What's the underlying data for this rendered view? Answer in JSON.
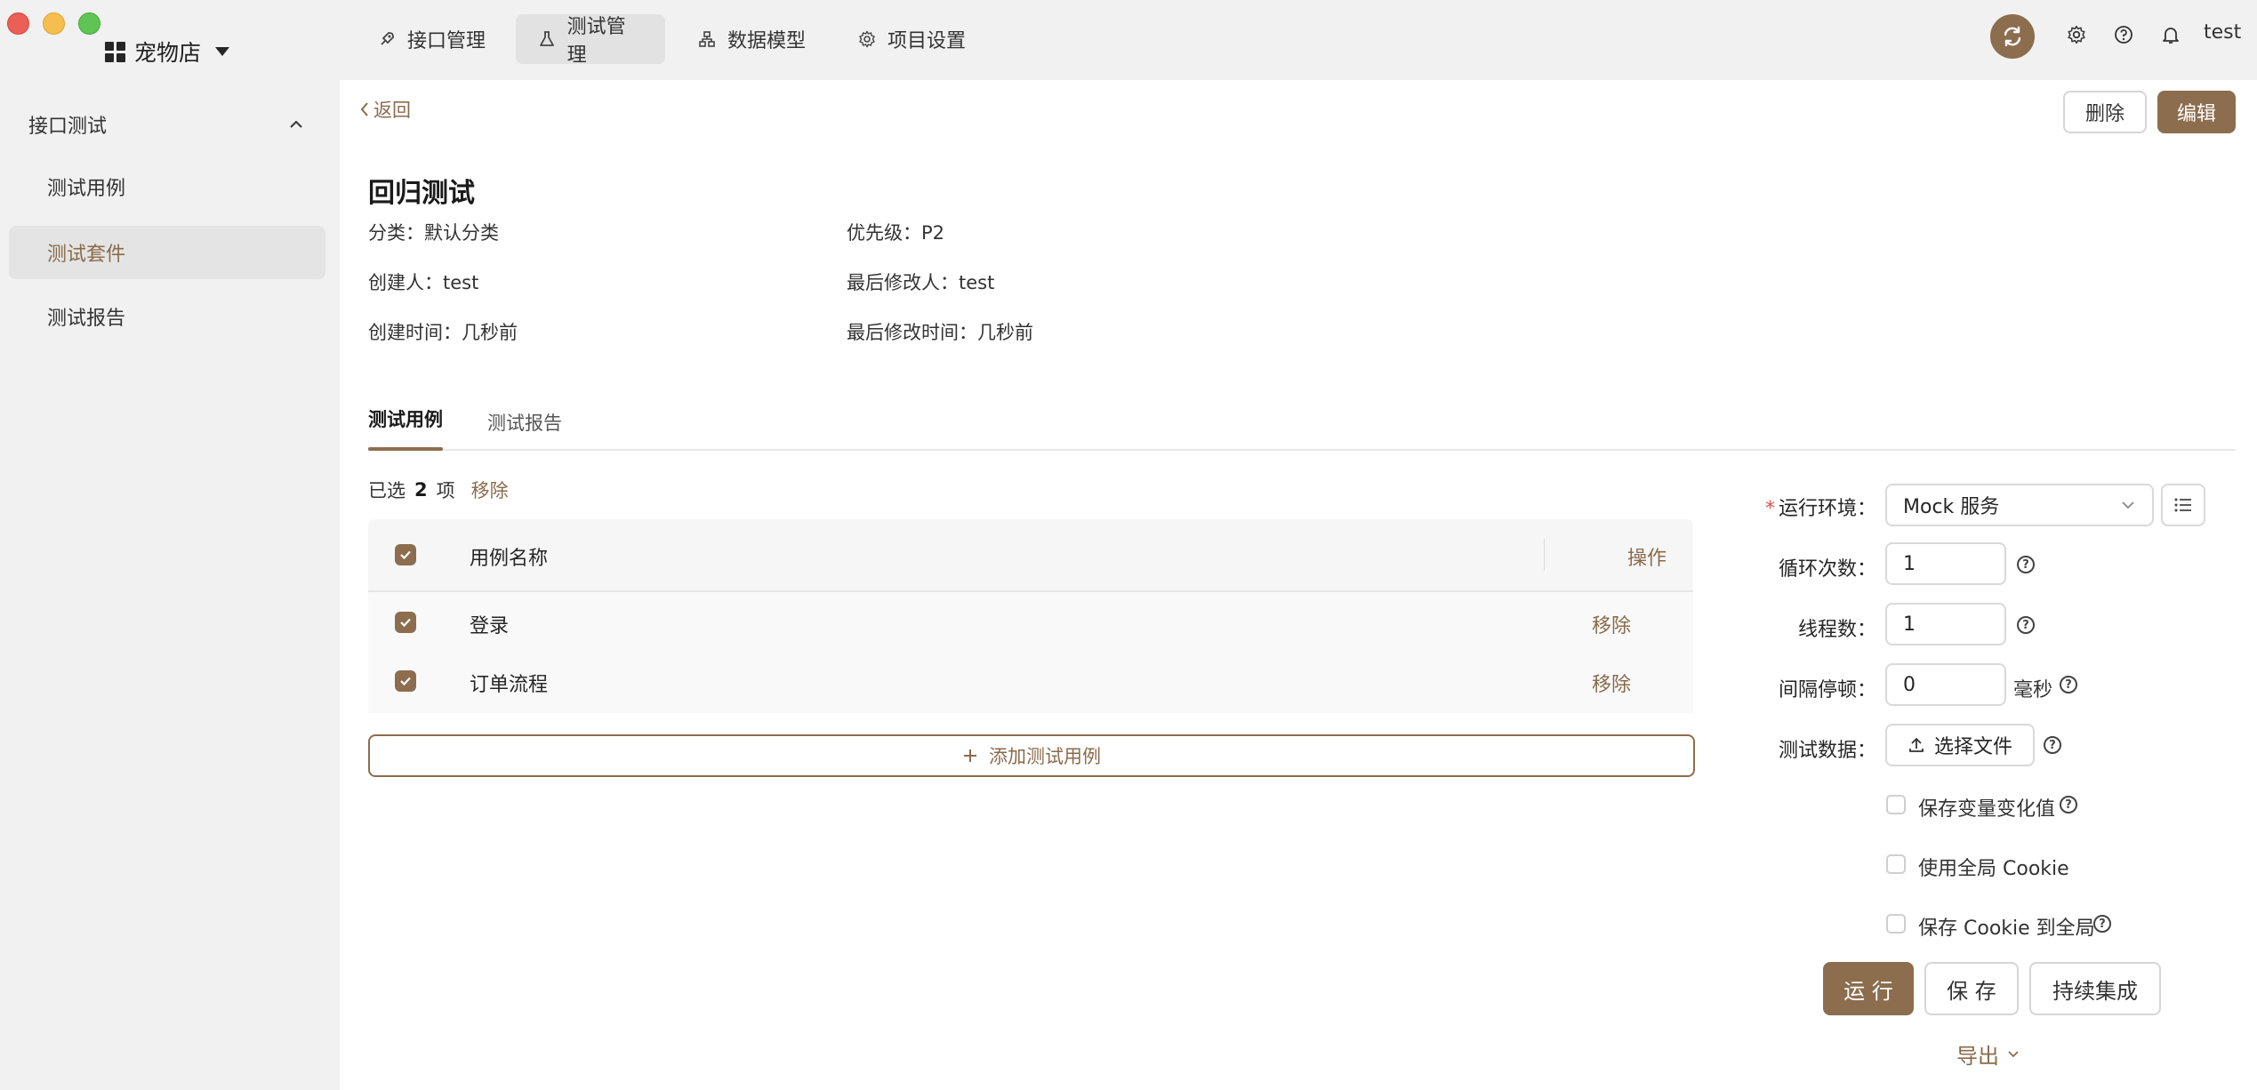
{
  "window": {
    "project_name": "宠物店"
  },
  "nav": {
    "tabs": [
      {
        "label": "接口管理",
        "icon": "rocket-icon"
      },
      {
        "label": "测试管理",
        "icon": "flask-icon"
      },
      {
        "label": "数据模型",
        "icon": "data-model-icon"
      },
      {
        "label": "项目设置",
        "icon": "gear-icon"
      }
    ],
    "active_tab": "测试管理",
    "user": "test"
  },
  "sidebar": {
    "group_label": "接口测试",
    "items": [
      {
        "label": "测试用例"
      },
      {
        "label": "测试套件"
      },
      {
        "label": "测试报告"
      }
    ],
    "active_item": "测试套件"
  },
  "header": {
    "back_label": "返回",
    "delete_label": "删除",
    "edit_label": "编辑"
  },
  "suite": {
    "title": "回归测试",
    "category_key": "分类：",
    "category_value": "默认分类",
    "priority_key": "优先级：",
    "priority_value": "P2",
    "creator_key": "创建人：",
    "creator_value": "test",
    "modifier_key": "最后修改人：",
    "modifier_value": "test",
    "created_key": "创建时间：",
    "created_value": "几秒前",
    "modified_key": "最后修改时间：",
    "modified_value": "几秒前"
  },
  "content_tabs": [
    {
      "label": "测试用例"
    },
    {
      "label": "测试报告"
    }
  ],
  "selection": {
    "prefix": "已选",
    "count": "2",
    "suffix": "项",
    "remove_label": "移除"
  },
  "table": {
    "columns": {
      "name": "用例名称",
      "action": "操作"
    },
    "rows": [
      {
        "name": "登录",
        "action": "移除",
        "checked": true
      },
      {
        "name": "订单流程",
        "action": "移除",
        "checked": true
      }
    ],
    "add_label": "添加测试用例"
  },
  "run_form": {
    "env_label": "运行环境",
    "env_value": "Mock 服务",
    "loop_label": "循环次数",
    "loop_value": "1",
    "thread_label": "线程数",
    "thread_value": "1",
    "interval_label": "间隔停顿",
    "interval_value": "0",
    "interval_unit": "毫秒",
    "data_label": "测试数据",
    "choose_file_label": "选择文件",
    "options": [
      {
        "label": "保存变量变化值",
        "checked": false,
        "help": true
      },
      {
        "label": "使用全局 Cookie",
        "checked": false,
        "help": false
      },
      {
        "label": "保存 Cookie 到全局",
        "checked": false,
        "help": true
      }
    ],
    "run_label": "运 行",
    "save_label": "保 存",
    "ci_label": "持续集成",
    "export_label": "导出",
    "colon": "："
  },
  "colors": {
    "accent": "#8c6d4e",
    "sidebar_bg": "#f1f1f1"
  }
}
